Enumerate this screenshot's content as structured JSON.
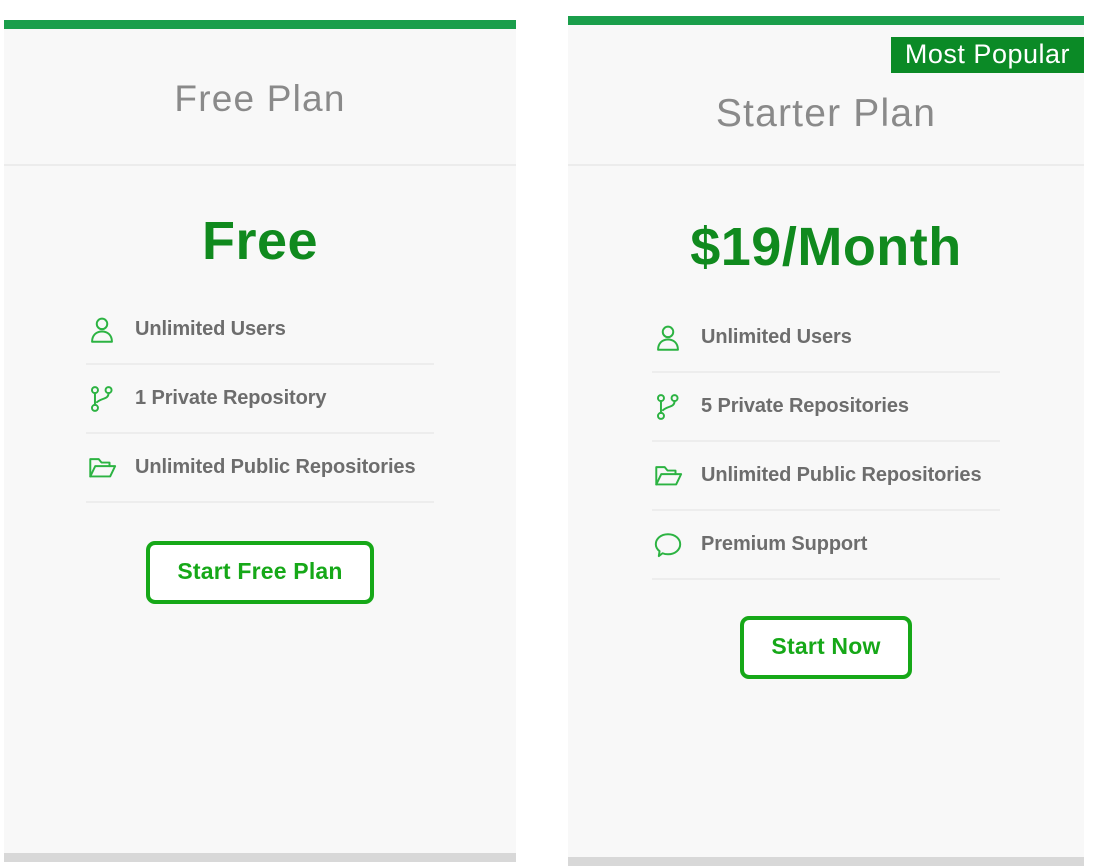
{
  "theme": {
    "card_background": "#f8f8f8",
    "topbar_green": "#1a9e4b",
    "badge_green": "#0b8a26",
    "price_green": "#108a1e",
    "button_green": "#16a818",
    "plan_name_gray": "#8a8a8a",
    "feature_text_gray": "#6d6d6d",
    "divider_gray": "#ededed",
    "footerbar_gray": "#d8d8d8"
  },
  "plans": [
    {
      "name": "Free Plan",
      "price": "Free",
      "badge": null,
      "features": [
        {
          "icon": "user-icon",
          "label": "Unlimited Users"
        },
        {
          "icon": "git-branch-icon",
          "label": "1 Private Repository"
        },
        {
          "icon": "open-folder-icon",
          "label": "Unlimited Public Repositories"
        }
      ],
      "cta_label": "Start Free Plan"
    },
    {
      "name": "Starter Plan",
      "price": "$19/Month",
      "badge": "Most Popular",
      "features": [
        {
          "icon": "user-icon",
          "label": "Unlimited Users"
        },
        {
          "icon": "git-branch-icon",
          "label": "5 Private Repositories"
        },
        {
          "icon": "open-folder-icon",
          "label": "Unlimited Public Repositories"
        },
        {
          "icon": "speech-bubble-icon",
          "label": "Premium Support"
        }
      ],
      "cta_label": "Start Now"
    }
  ]
}
